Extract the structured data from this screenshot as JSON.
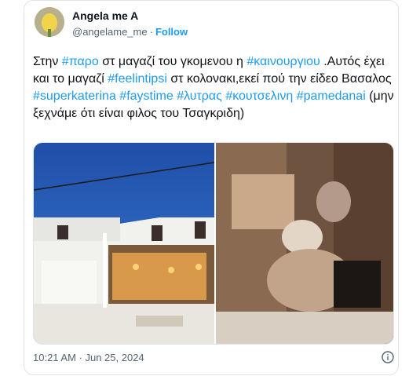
{
  "tweet": {
    "author_name": "Angela me A",
    "handle": "@angelame_me",
    "separator": "·",
    "follow_label": "Follow",
    "text_runs": [
      {
        "t": "Στην ",
        "tag": false
      },
      {
        "t": "#παρο",
        "tag": true
      },
      {
        "t": " στ μαγαζί του γκομενου η ",
        "tag": false
      },
      {
        "t": "#καινουργιου",
        "tag": true
      },
      {
        "t": " .Αυτός έχει και το μαγαζί ",
        "tag": false
      },
      {
        "t": "#feelintipsi",
        "tag": true
      },
      {
        "t": " στ κολονακι,εκεί πού την είδεο Βασαλος ",
        "tag": false
      },
      {
        "t": "#superkaterina",
        "tag": true
      },
      {
        "t": " ",
        "tag": false
      },
      {
        "t": "#faystime",
        "tag": true
      },
      {
        "t": " ",
        "tag": false
      },
      {
        "t": "#λυτρας",
        "tag": true
      },
      {
        "t": " ",
        "tag": false
      },
      {
        "t": "#κουτσελινη",
        "tag": true
      },
      {
        "t": " ",
        "tag": false
      },
      {
        "t": "#pamedanai",
        "tag": true
      },
      {
        "t": " (μην ξεχνάμε ότι είναι φιλος του Τσαγκριδη)",
        "tag": false
      }
    ],
    "timestamp": "10:21 AM · Jun 25, 2024",
    "icons": {
      "info": "info-circle-icon"
    }
  },
  "colors": {
    "link": "#1d9bf0",
    "text": "#0f1419",
    "muted": "#536471",
    "border": "#dfe4e8"
  }
}
